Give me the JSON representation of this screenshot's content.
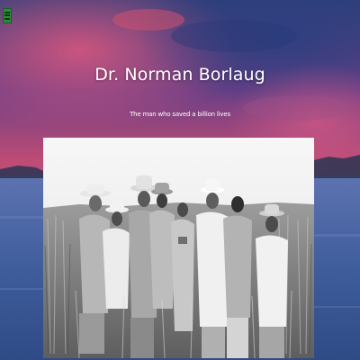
{
  "hero": {
    "title": "Dr. Norman Borlaug",
    "subtitle": "The man who saved a billion lives"
  },
  "nav": {
    "menu_icon": "hamburger-menu-icon"
  },
  "photo": {
    "subject": "photo of men in a wheat field"
  },
  "colors": {
    "sky_top": "#3a4f86",
    "sky_pink": "#b8486e",
    "sky_purple": "#5a3d7a",
    "water": "#3f5f9a",
    "text": "#ffffff",
    "menu_green": "#2f8a3a"
  }
}
